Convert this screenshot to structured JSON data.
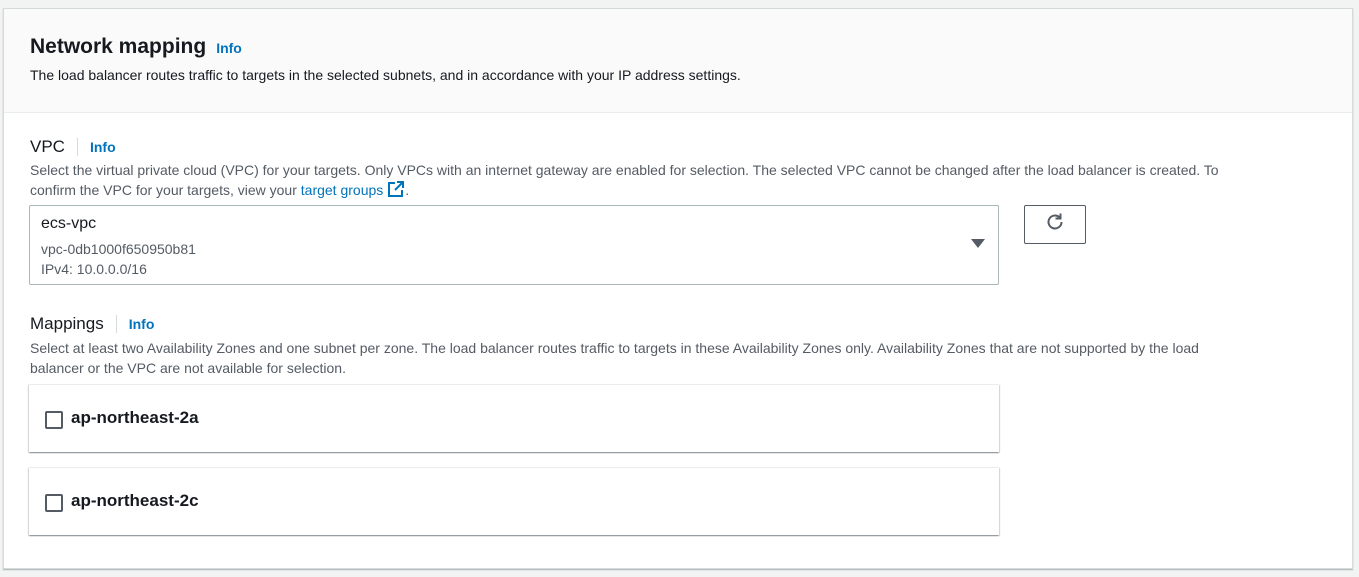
{
  "header": {
    "title": "Network mapping",
    "info": "Info",
    "description": "The load balancer routes traffic to targets in the selected subnets, and in accordance with your IP address settings."
  },
  "vpc": {
    "label": "VPC",
    "info": "Info",
    "description_line1": "Select the virtual private cloud (VPC) for your targets. Only VPCs with an internet gateway are enabled for selection. The selected VPC cannot be changed after the load balancer is created. To",
    "description_line2_prefix": "confirm the VPC for your targets, view your ",
    "description_link": "target groups",
    "description_line2_suffix": ".",
    "selected": {
      "name": "ecs-vpc",
      "id": "vpc-0db1000f650950b81",
      "cidr": "IPv4: 10.0.0.0/16"
    },
    "icons": {
      "dropdown": "caret-down-icon",
      "refresh": "refresh-icon",
      "external": "external-link-icon"
    }
  },
  "mappings": {
    "label": "Mappings",
    "info": "Info",
    "description_line1": "Select at least two Availability Zones and one subnet per zone. The load balancer routes traffic to targets in these Availability Zones only. Availability Zones that are not supported by the load",
    "description_line2": "balancer or the VPC are not available for selection.",
    "zones": [
      {
        "name": "ap-northeast-2a",
        "checked": false
      },
      {
        "name": "ap-northeast-2c",
        "checked": false
      }
    ]
  },
  "colors": {
    "link": "#0073bb",
    "text": "#16191f",
    "secondary_text": "#545b64",
    "border": "#aab7b8"
  }
}
